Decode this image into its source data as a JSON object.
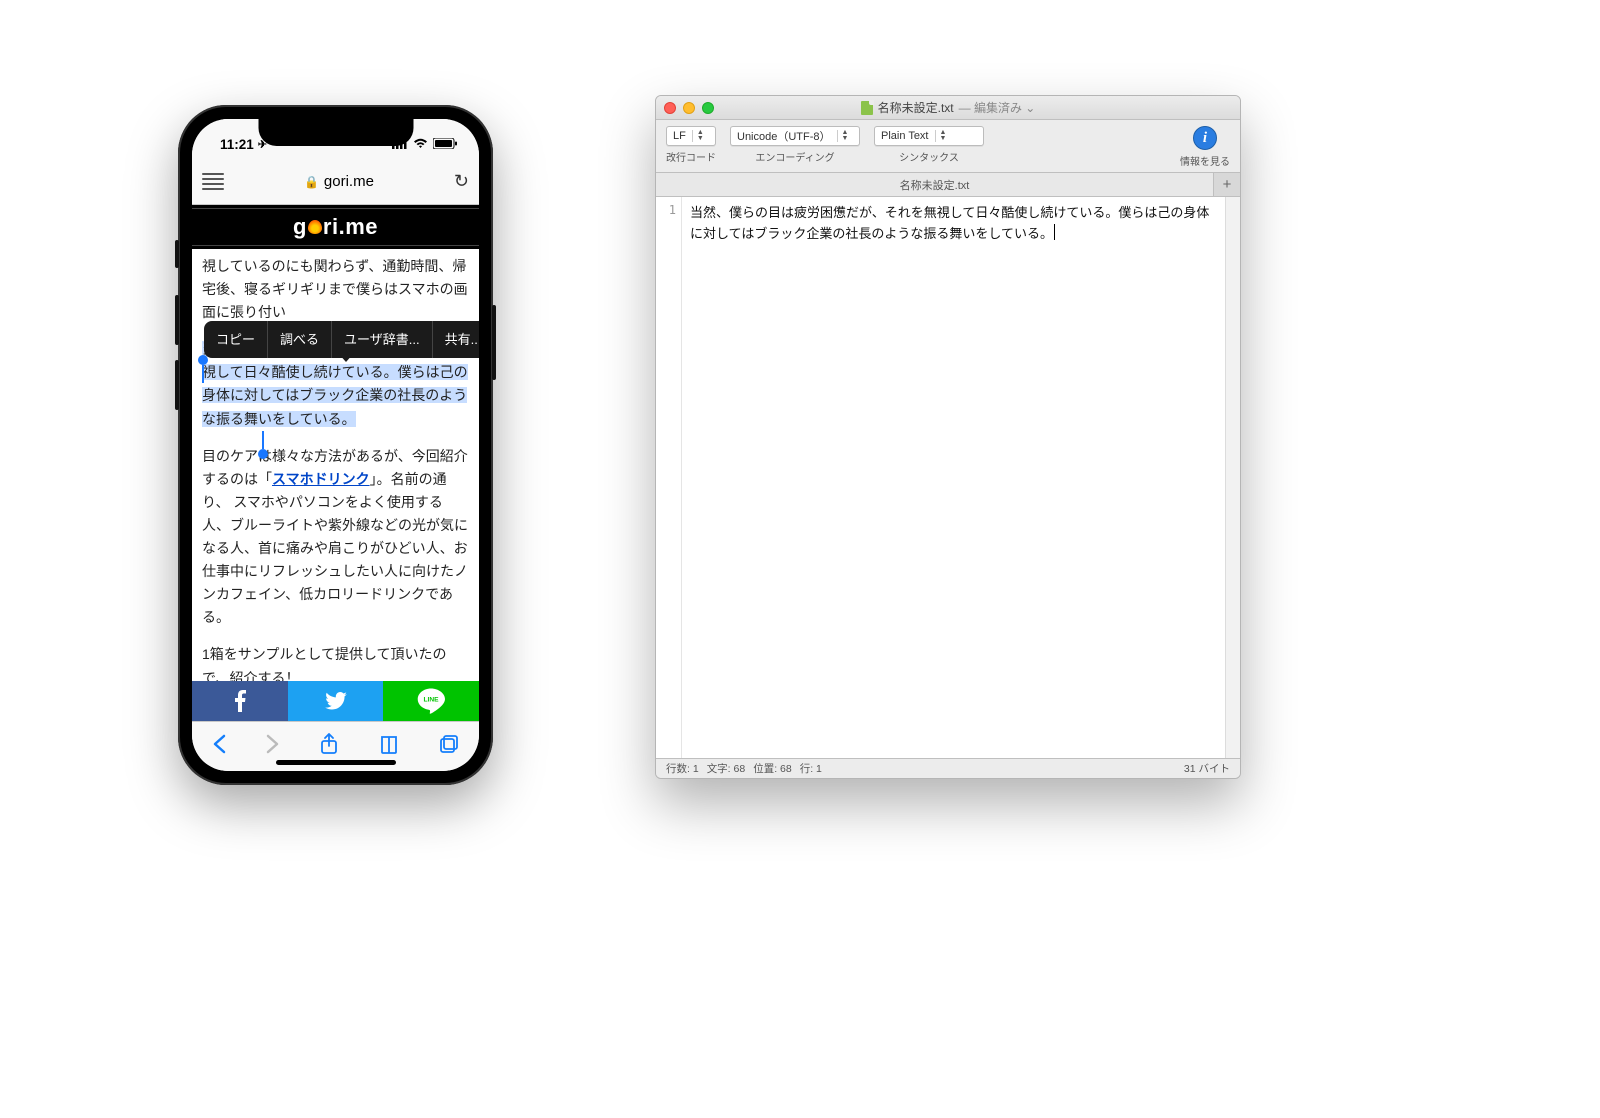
{
  "phone": {
    "status": {
      "time": "11:21",
      "location_arrow": "➤"
    },
    "safari_addr": {
      "lock": "🔒",
      "domain": "gori.me"
    },
    "site_logo_left": "g",
    "site_logo_right": "ri.me",
    "article": {
      "p1": "視しているのにも関わらず、通勤時間、帰宅後、寝るギリギリまで僕らはスマホの画面に張り付い",
      "selected": "当然、僕らの目は疲労困憊だが、それを無視して日々酷使し続けている。僕らは己の身体に対してはブラック企業の社長のような振る舞いをしている。",
      "p3a": "目のケアは様々な方法があるが、今回紹介するのは「",
      "p3link": "スマホドリンク",
      "p3b": "」。名前の通り、 スマホやパソコンをよく使用する人、ブルーライトや紫外線などの光が気になる人、首に痛みや肩こりがひどい人、お仕事中にリフレッシュしたい人に向けたノンカフェイン、低カロリードリンクである。",
      "p4": "1箱をサンプルとして提供して頂いたので、紹介する！"
    },
    "context_menu": {
      "copy": "コピー",
      "lookup": "調べる",
      "user_dict": "ユーザ辞書...",
      "share": "共有..."
    }
  },
  "editor": {
    "titlebar": {
      "filename": "名称未設定.txt",
      "edited_suffix": " — 編集済み ⌄"
    },
    "toolbar": {
      "lf": {
        "value": "LF",
        "label": "改行コード"
      },
      "encoding": {
        "value": "Unicode（UTF-8）",
        "label": "エンコーディング"
      },
      "syntax": {
        "value": "Plain Text",
        "label": "シンタックス"
      },
      "info_label": "情報を見る"
    },
    "tab_title": "名称未設定.txt",
    "line_number": "1",
    "text": "当然、僕らの目は疲労困憊だが、それを無視して日々酷使し続けている。僕らは己の身体に対してはブラック企業の社長のような振る舞いをしている。",
    "status": {
      "lines": "行数: 1",
      "chars": "文字: 68",
      "pos": "位置: 68",
      "row": "行: 1",
      "bytes": "31 バイト"
    }
  }
}
